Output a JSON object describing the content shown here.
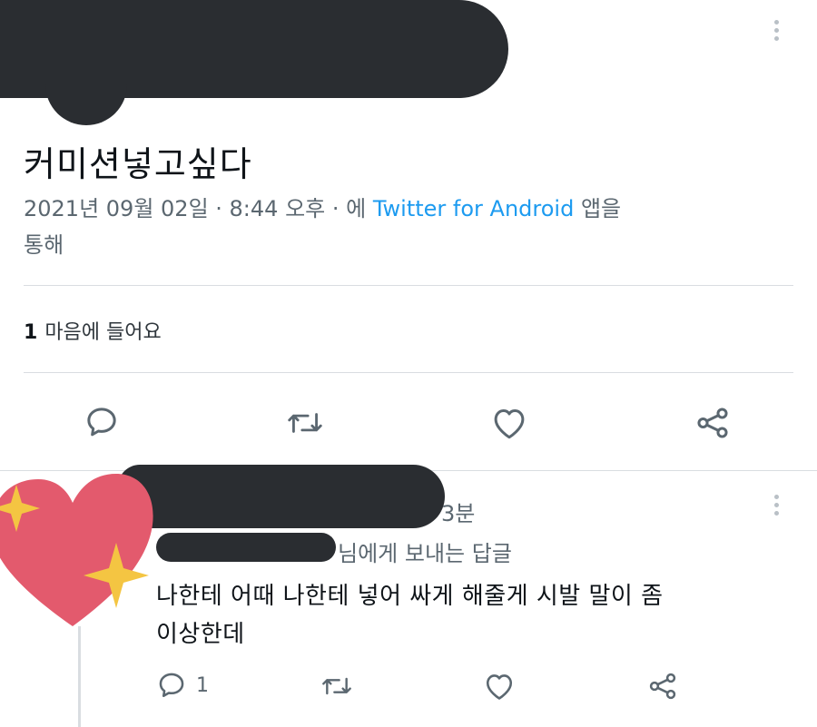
{
  "tweet": {
    "text": "커미션넣고싶다",
    "date": "2021년 09월 02일 · 8:44 오후 · 에 ",
    "client": "Twitter for Android",
    "client_suffix": " 앱을",
    "line2": "통해",
    "likes_count": "1",
    "likes_label": "마음에 들어요"
  },
  "actions": {
    "reply_icon": "reply-bubble-icon",
    "retweet_icon": "retweet-icon",
    "like_icon": "heart-outline-icon",
    "share_icon": "share-icon"
  },
  "reply": {
    "time": "3분",
    "replying_to": "님에게 보내는 답글",
    "text_line1": "나한테 어때 나한테 넣어 싸게 해줄게 시발 말이 좀",
    "text_line2": "이상한데",
    "reply_count": "1"
  },
  "colors": {
    "link": "#1d9bf0",
    "secondary_text": "#5b6770",
    "redaction": "#2a2d31",
    "heart_sticker": "#e35a6d",
    "sparkle": "#f4c542"
  }
}
